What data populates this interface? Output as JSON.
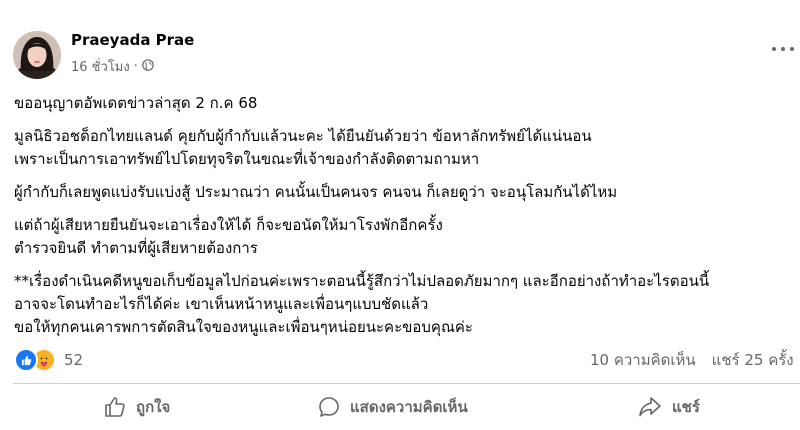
{
  "post": {
    "author": "Praeyada Prae",
    "time": "16 ชั่วโมง",
    "separator": "·",
    "audience_icon": "globe-icon",
    "more_icon": "more-options-icon",
    "paragraphs": [
      [
        "ขออนุญาตอัพเดตข่าวล่าสุด 2 ก.ค 68"
      ],
      [
        "มูลนิธิวอชด็อกไทยแลนด์ คุยกับผู้กำกับแล้วนะคะ ได้ยืนยันด้วยว่า ข้อหาลักทรัพย์ได้แน่นอน",
        "เพราะเป็นการเอาทรัพย์ไปโดยทุจริตในขณะที่เจ้าของกำลังติดตามถามหา"
      ],
      [
        "ผู้กำกับก็เลยพูดแบ่งรับแบ่งสู้ ประมาณว่า คนนั้นเป็นคนจร คนจน ก็เลยดูว่า จะอนุโลมกันได้ไหม"
      ],
      [
        "แต่ถ้าผู้เสียหายยืนยันจะเอาเรื่องให้ได้ ก็จะขอนัดให้มาโรงพักอีกครั้ง",
        "ตำรวจยินดี ทำตามที่ผู้เสียหายต้องการ"
      ],
      [
        "**เรื่องดำเนินคดีหนูขอเก็บข้อมูลไปก่อนค่ะเพราะตอนนี้รู้สึกว่าไม่ปลอดภัยมากๆ และอีกอย่างถ้าทำอะไรตอนนี้",
        "อาจจะโดนทำอะไรก็ได้ค่ะ เขาเห็นหน้าหนูและเพื่อนๆแบบชัดแล้ว",
        "ขอให้ทุกคนเคารพการตัดสินใจของหนูและเพื่อนๆหน่อยนะคะขอบคุณค่ะ"
      ]
    ]
  },
  "reactions": {
    "icons": [
      "like-reaction-icon",
      "care-reaction-icon"
    ],
    "count": "52",
    "comments": "10 ความคิดเห็น",
    "shares": "แชร์ 25 ครั้ง"
  },
  "actions": {
    "like": "ถูกใจ",
    "comment": "แสดงความคิดเห็น",
    "share": "แชร์"
  },
  "colors": {
    "text": "#050505",
    "secondary": "#65676b",
    "like_blue": "#1877f2",
    "care_yellow": "#f7b125",
    "divider": "#ced0d4"
  }
}
